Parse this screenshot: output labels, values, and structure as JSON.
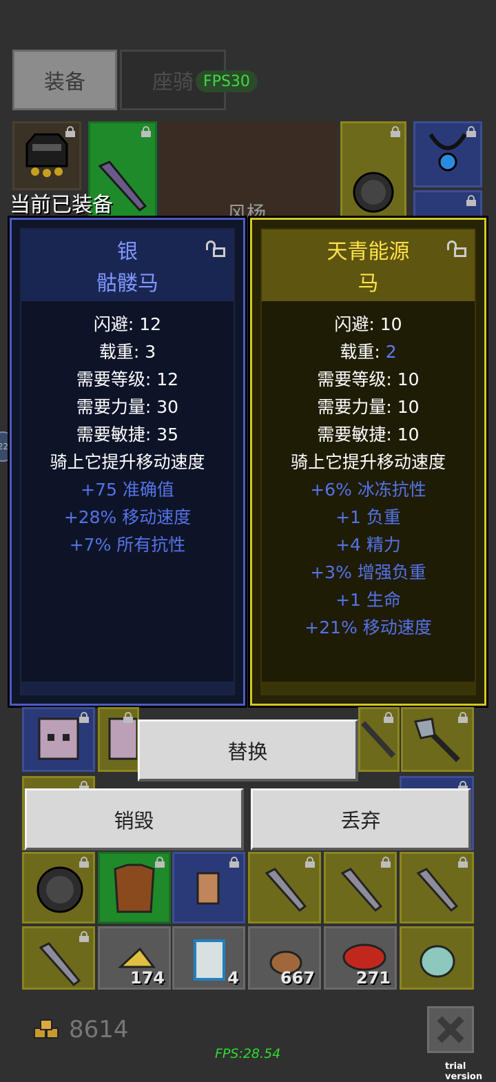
{
  "tabs": {
    "equip": "装备",
    "mount": "座骑"
  },
  "fps_badge": "FPS30",
  "equipped_label": "当前已装备",
  "background_text": "风杨",
  "side_knob": "22",
  "left_item": {
    "title_line1": "银",
    "title_line2": "骷髅马",
    "stats": [
      "闪避: 12",
      "载重: 3",
      "需要等级: 12",
      "需要力量: 30",
      "需要敏捷: 35",
      "骑上它提升移动速度"
    ],
    "bonuses": [
      "+75 准确值",
      "+28% 移动速度",
      "+7% 所有抗性"
    ]
  },
  "right_item": {
    "title_line1": "天青能源",
    "title_line2": "马",
    "stats": [
      "闪避: 10",
      "需要等级: 10",
      "需要力量: 10",
      "需要敏捷: 10",
      "骑上它提升移动速度"
    ],
    "load_label": "载重: ",
    "load_value": "2",
    "bonuses": [
      "+6% 冰冻抗性",
      "+1 负重",
      "+4 精力",
      "+3% 增强负重",
      "+1 生命",
      "+21% 移动速度"
    ]
  },
  "buttons": {
    "replace": "替换",
    "destroy": "销毁",
    "discard": "丢弃"
  },
  "inventory_counts": [
    "174",
    "4",
    "667",
    "271"
  ],
  "gold": "8614",
  "fps_bottom": "FPS:28.54",
  "trial": "trial version",
  "colors": {
    "accent_blue": "#4c5cc4",
    "accent_yellow": "#d2c824",
    "bonus_blue": "#5573e6"
  }
}
